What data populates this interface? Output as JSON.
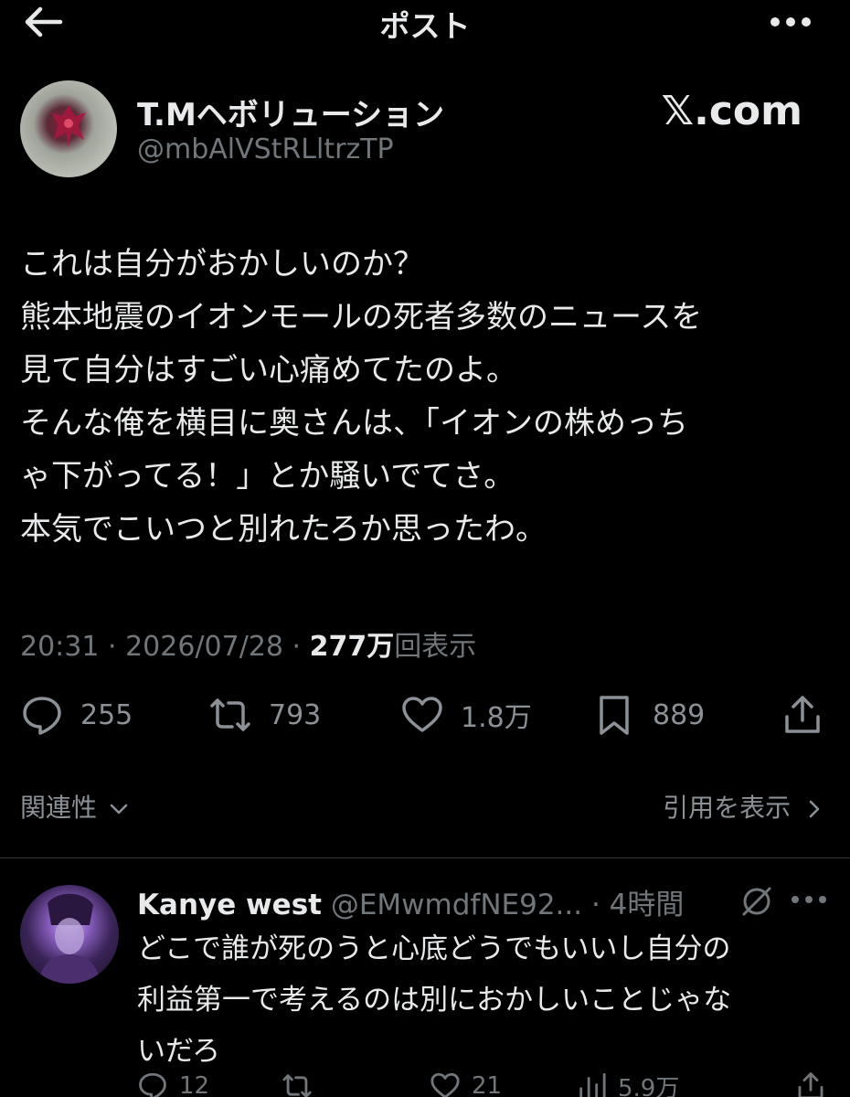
{
  "header": {
    "title": "ポスト"
  },
  "post": {
    "author_name": "T.Mヘボリューション",
    "author_handle": "@mbAlVStRLltrzTP",
    "brand": "𝕏.com",
    "lines": [
      "これは自分がおかしいのか？",
      "熊本地震のイオンモールの死者多数のニュースを",
      "見て自分はすごい心痛めてたのよ。",
      "そんな俺を横目に奥さんは、「イオンの株めっち",
      "ゃ下がってる！」とか騒いでてさ。",
      "本気でこいつと別れたろか思ったわ。"
    ],
    "time": "20:31",
    "date": "2026/07/28",
    "views_count": "277万",
    "views_label": "回表示",
    "replies": "255",
    "reposts": "793",
    "likes": "1.8万",
    "bookmarks": "889"
  },
  "sort": {
    "label": "関連性",
    "quotes_label": "引用を表示"
  },
  "reply": {
    "author_name": "Kanye west",
    "author_handle": "@EMwmdfNE92...",
    "time": "4時間",
    "lines": [
      "どこで誰が死のうと心底どうでもいいし自分の",
      "利益第一で考えるのは別におかしいことじゃな",
      "いだろ"
    ],
    "replies": "12",
    "likes": "21",
    "views": "5.9万"
  },
  "colors": {
    "background": "#000000",
    "text": "#e7e9ea",
    "secondary": "#71767b",
    "divider": "#2f3336"
  },
  "icons": [
    "back-arrow-icon",
    "more-icon",
    "reply-icon",
    "repost-icon",
    "like-icon",
    "bookmark-icon",
    "share-icon",
    "chevron-down-icon",
    "chevron-right-icon",
    "grok-icon",
    "views-icon"
  ]
}
